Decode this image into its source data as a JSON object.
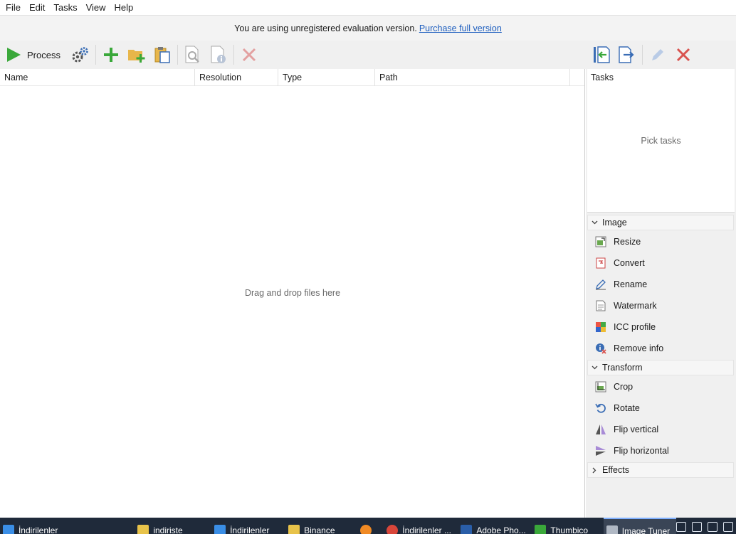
{
  "menu": [
    "File",
    "Edit",
    "Tasks",
    "View",
    "Help"
  ],
  "banner": {
    "text": "You are using unregistered evaluation version.",
    "link": "Purchase full version"
  },
  "toolbar": {
    "process_label": "Process"
  },
  "file_list": {
    "columns": [
      "Name",
      "Resolution",
      "Type",
      "Path"
    ],
    "empty_message": "Drag and drop files here"
  },
  "tasks_panel": {
    "title": "Tasks",
    "empty_message": "Pick tasks",
    "groups": [
      {
        "label": "Image",
        "expanded": true,
        "items": [
          {
            "label": "Resize",
            "icon": "resize-icon"
          },
          {
            "label": "Convert",
            "icon": "convert-icon"
          },
          {
            "label": "Rename",
            "icon": "rename-icon"
          },
          {
            "label": "Watermark",
            "icon": "watermark-icon"
          },
          {
            "label": "ICC profile",
            "icon": "icc-profile-icon"
          },
          {
            "label": "Remove info",
            "icon": "remove-info-icon"
          }
        ]
      },
      {
        "label": "Transform",
        "expanded": true,
        "items": [
          {
            "label": "Crop",
            "icon": "crop-icon"
          },
          {
            "label": "Rotate",
            "icon": "rotate-icon"
          },
          {
            "label": "Flip vertical",
            "icon": "flip-vertical-icon"
          },
          {
            "label": "Flip horizontal",
            "icon": "flip-horizontal-icon"
          }
        ]
      },
      {
        "label": "Effects",
        "expanded": false,
        "items": []
      }
    ]
  },
  "taskbar": {
    "items": [
      {
        "label": "İndirilenler",
        "icon": "folder-download-icon"
      },
      {
        "label": "indiriste",
        "icon": "folder-icon"
      },
      {
        "label": "İndirilenler",
        "icon": "download-arrow-icon"
      },
      {
        "label": "Binance",
        "icon": "folder-icon"
      },
      {
        "label": "",
        "icon": "firefox-icon"
      },
      {
        "label": "İndirilenler ...",
        "icon": "chrome-icon"
      },
      {
        "label": "Adobe Pho...",
        "icon": "photoshop-icon"
      },
      {
        "label": "Thumbico",
        "icon": "thumbico-icon"
      },
      {
        "label": "Image Tuner",
        "icon": "image-tuner-icon",
        "active": true
      }
    ]
  },
  "colors": {
    "accent_green": "#3aa83a",
    "delete_red": "#d9534f",
    "link_blue": "#1f5fbf",
    "taskbar_bg": "#1f2a3a"
  }
}
